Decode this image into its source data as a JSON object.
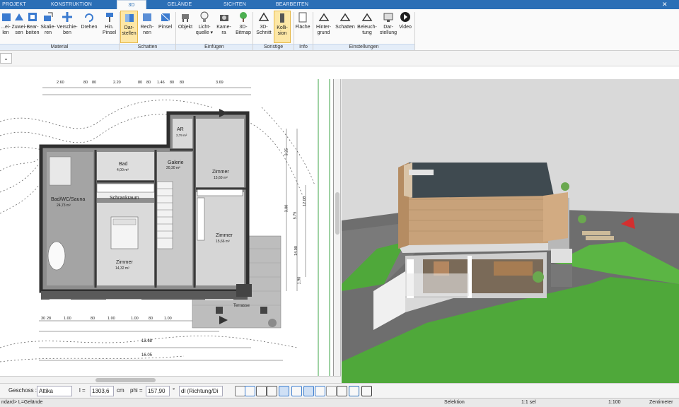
{
  "tabs": [
    {
      "label": "PROJEKT",
      "active": false
    },
    {
      "label": "KONSTRUKTION",
      "active": false
    },
    {
      "label": "3D",
      "active": true
    },
    {
      "label": "GELÄNDE",
      "active": false
    },
    {
      "label": "SICHTEN",
      "active": false
    },
    {
      "label": "BEARBEITEN",
      "active": false
    }
  ],
  "ribbon": {
    "buttons": [
      {
        "l1": "...ei-",
        "l2": "len",
        "icon": "cube-icon"
      },
      {
        "l1": "Zuwei-",
        "l2": "sen",
        "icon": "assign-icon"
      },
      {
        "l1": "Bear-",
        "l2": "beiten",
        "icon": "edit-icon"
      },
      {
        "l1": "Skalie-",
        "l2": "ren",
        "icon": "scale-icon"
      },
      {
        "l1": "Verschie-",
        "l2": "ben",
        "icon": "move-icon"
      },
      {
        "l1": "Drehen",
        "l2": "",
        "icon": "rotate-icon"
      },
      {
        "l1": "Hin.",
        "l2": "Pinsel",
        "icon": "brush-icon"
      },
      {
        "l1": "Dar-",
        "l2": "stellen",
        "icon": "display-icon"
      },
      {
        "l1": "Rech-",
        "l2": "nen",
        "icon": "calculate-icon"
      },
      {
        "l1": "Pinsel",
        "l2": "",
        "icon": "paint-icon"
      },
      {
        "l1": "Objekt",
        "l2": "",
        "icon": "object-icon"
      },
      {
        "l1": "Licht-",
        "l2": "quelle ▾",
        "icon": "bulb-icon"
      },
      {
        "l1": "Kame-",
        "l2": "ra",
        "icon": "camera-icon"
      },
      {
        "l1": "3D-",
        "l2": "Bitmap",
        "icon": "tree-icon"
      },
      {
        "l1": "3D-",
        "l2": "Schnitt",
        "icon": "section-icon"
      },
      {
        "l1": "Kolli-",
        "l2": "sion",
        "icon": "collision-icon"
      },
      {
        "l1": "Fläche",
        "l2": "",
        "icon": "area-icon"
      },
      {
        "l1": "Hinter-",
        "l2": "grund",
        "icon": "background-icon"
      },
      {
        "l1": "Schatten",
        "l2": "",
        "icon": "shadow-icon"
      },
      {
        "l1": "Beleuch-",
        "l2": "tung",
        "icon": "lighting-icon"
      },
      {
        "l1": "Dar-",
        "l2": "stellung",
        "icon": "monitor-icon"
      },
      {
        "l1": "Video",
        "l2": "",
        "icon": "play-icon"
      }
    ],
    "groups": [
      "Material",
      "Schatten",
      "Einfügen",
      "Sonstige",
      "Info",
      "Einstellungen"
    ]
  },
  "plan": {
    "rooms": [
      {
        "name": "Bad",
        "area": "4,00 m²"
      },
      {
        "name": "Galerie",
        "area": "20,30 m²"
      },
      {
        "name": "Zimmer",
        "area": "15,60 m²"
      },
      {
        "name": "Schrankraum",
        "area": ""
      },
      {
        "name": "Bad/WC/Sauna",
        "area": "24,73 m²"
      },
      {
        "name": "Zimmer",
        "area": "14,32 m²"
      },
      {
        "name": "Zimmer",
        "area": "15,66 m²"
      },
      {
        "name": "AR",
        "area": "2,79 m²"
      },
      {
        "name": "Terrasse",
        "area": ""
      }
    ],
    "top_dims": [
      "2.60",
      "80",
      "80",
      "2.20",
      "80",
      "80",
      "1.46",
      "80",
      "80",
      "3.69"
    ],
    "bottom_dims": [
      "30",
      "28",
      "1.00",
      "80",
      "1.00",
      "1.00",
      "80",
      "1.00"
    ],
    "total_dims": [
      "13.68",
      "16.05"
    ],
    "right_dims": [
      "3.25",
      "3.00",
      "5.75",
      "14.00",
      "12.00",
      "1.90"
    ]
  },
  "controls": {
    "geschoss_label": "Geschoss :",
    "geschoss_value": "Attika",
    "l_label": "l =",
    "l_value": "1303,6",
    "l_unit": "cm",
    "phi_label": "phi =",
    "phi_value": "157,90",
    "phi_unit": "°",
    "mode_value": "dl (Richtung/Di"
  },
  "status": {
    "left": "ndard> L=Gelände",
    "selection": "Selektion",
    "selcount": "1:1 sel",
    "scale": "1:100",
    "unit": "Zentimeter"
  },
  "colors": {
    "tabbar": "#2b6fb6",
    "active_button": "#fde7a6",
    "wall": "#3a3a3a",
    "grass": "#4fa83a",
    "wood": "#c8a27a"
  }
}
